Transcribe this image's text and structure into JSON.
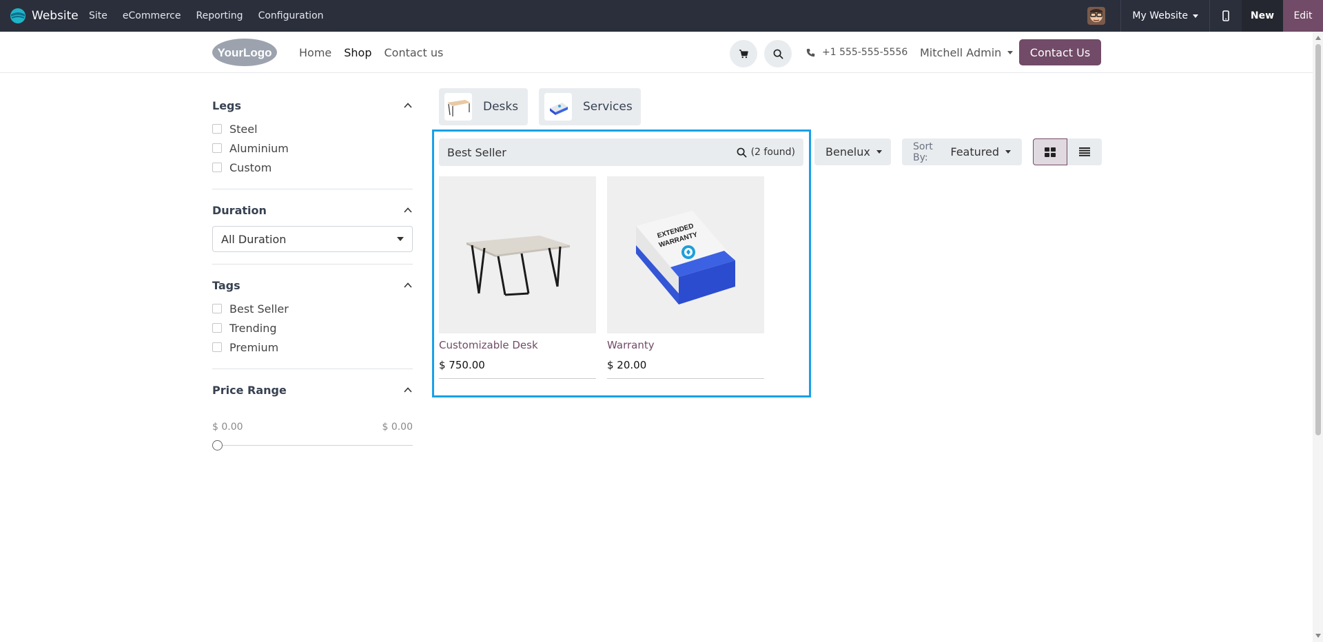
{
  "adminbar": {
    "app_name": "Website",
    "menu": [
      "Site",
      "eCommerce",
      "Reporting",
      "Configuration"
    ],
    "website_switcher": "My Website",
    "new_label": "New",
    "edit_label": "Edit",
    "edit_color": "#714b67"
  },
  "header": {
    "logo_text": "YourLogo",
    "nav": [
      "Home",
      "Shop",
      "Contact us"
    ],
    "active_nav": "Shop",
    "phone": "+1 555-555-5556",
    "user": "Mitchell Admin",
    "contact_button": "Contact Us"
  },
  "sidebar": {
    "legs": {
      "title": "Legs",
      "options": [
        "Steel",
        "Aluminium",
        "Custom"
      ]
    },
    "duration": {
      "title": "Duration",
      "selected": "All Duration"
    },
    "tags": {
      "title": "Tags",
      "options": [
        "Best Seller",
        "Trending",
        "Premium"
      ]
    },
    "price_range": {
      "title": "Price Range",
      "min": "$ 0.00",
      "max": "$ 0.00"
    }
  },
  "categories": [
    {
      "label": "Desks",
      "icon": "desk-thumbnail"
    },
    {
      "label": "Services",
      "icon": "services-thumbnail"
    }
  ],
  "search": {
    "value": "Best Seller",
    "found": "(2 found)"
  },
  "pricelist": "Benelux",
  "sort": {
    "prefix": "Sort By:",
    "value": "Featured"
  },
  "products": [
    {
      "name": "Customizable Desk",
      "price": "$ 750.00",
      "image": "desk-image"
    },
    {
      "name": "Warranty",
      "price": "$ 20.00",
      "image": "warranty-box-image"
    }
  ],
  "warranty_box_text": [
    "EXTENDED",
    "WARRANTY"
  ],
  "colors": {
    "accent": "#714b67",
    "highlight": "#18a0e8",
    "adminbar": "#2b2f3c"
  }
}
